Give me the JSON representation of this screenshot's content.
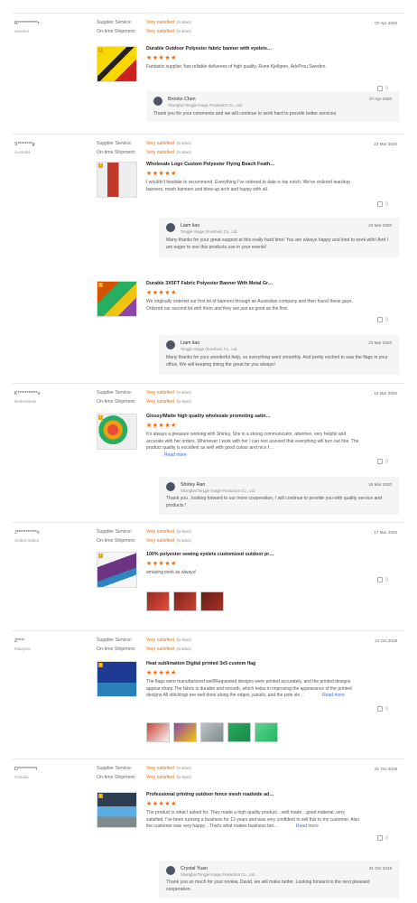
{
  "labels": {
    "supplier_service": "Supplier Service:",
    "ontime_shipment": "On-time Shipment:",
    "very_satisfied": "Very satisfied",
    "five_stars": "(5 stars)",
    "read_more": "Read more"
  },
  "reviews": [
    {
      "buyer": "R***********r",
      "country": "Sweden",
      "date": "07 Apr 2020",
      "products": [
        {
          "title": "Durable Outdoor Polyester fabric banner with eyelets…",
          "stars": "★★★★★",
          "comment": "Fantastic supplier, fast reliable deliveries of high quality. Rune Kjellgren, AdvProu Sweden.",
          "likes": "0",
          "tag": "I"
        }
      ],
      "reply": {
        "name": "Brooks Chen",
        "company": "Shanghai Tongjie Image Production Co., Ltd.",
        "date": "07 Apr 2020",
        "text": "Thank you for your comments and we will continue to work hard to provide better services."
      }
    },
    {
      "buyer": "S********g",
      "country": "Australia",
      "date": "23 Mar 2020",
      "products": [
        {
          "title": "Wholesale Logo Custom Polyester Flying Beach Feath…",
          "stars": "★★★★★",
          "comment": "I wouldn't hesitate to recommend. Everything I've ordered to date is top notch. We've ordered teardrop banners, mesh banners and blow-up arch and happy with all.",
          "likes": "0",
          "tag": "I",
          "reply": {
            "name": "Liam liao",
            "company": "Tongjie Image (Kunshan) Co., Ltd.",
            "date": "23 Mar 2020",
            "text": "Many thanks for your great support at this really hard time! You are always happy and kind to work with! And I am eager to see this products use in your events!"
          }
        },
        {
          "title": "Durable 3X5FT Fabric Polyester Banner With Metal Gr…",
          "stars": "★★★★★",
          "comment": "We originally ordered our first lot of banners through an Australian company and then found these guys. Ordered our second lot with them and they are just as good as the first.",
          "likes": "0",
          "tag": "I",
          "reply": {
            "name": "Liam liao",
            "company": "Tongjie Image (Kunshan) Co., Ltd.",
            "date": "23 Mar 2020",
            "text": "Many thanks for your wonderful help, so everything went smoothly. And pretty excited to saw the flags in your office, We will keeping doing the great for you always!"
          }
        }
      ]
    },
    {
      "buyer": "K***********o",
      "country": "Netherlands",
      "date": "18 Mar 2020",
      "products": [
        {
          "title": "Glossy/Matte high quality wholesale promoting satin…",
          "stars": "★★★★★",
          "comment": "It's always a pleasure working with Shirley. She is a strong communicator, attentive, very helpful and accurate with her orders. Whenever I work with her I can rest assured that everything will turn out fine. The product quality is excellent as well with good colour and nice f…",
          "likes": "0",
          "tag": "I"
        }
      ],
      "reply": {
        "name": "Shirley Ran",
        "company": "Shanghai Tongjie Image Production Co., Ltd.",
        "date": "18 Mar 2020",
        "text": "Thank you , looking forward to our more cooperation, I will continue to provide you with quality service and products !"
      }
    },
    {
      "buyer": "J***********n",
      "country": "United States",
      "date": "17 Mar 2020",
      "products": [
        {
          "title": "100% polyester sewing eyelets customized outdoor pr…",
          "stars": "★★★★★",
          "comment": "amazing work as always!",
          "likes": "0",
          "tag": "I"
        }
      ]
    },
    {
      "buyer": "Z****",
      "country": "Malaysia",
      "date": "13 Oct 2019",
      "products": [
        {
          "title": "Heat sublimation Digital printed 3x5 custom flag",
          "stars": "★★★★★",
          "comment": "The flags were manufactured well!Requested designs were printed accurately, and the printed designs appear sharp.The fabric is durable and smooth, which helps in improving the appearance of the printed designs.All stitchings are well done along the edges, panels, and the pole sle…",
          "likes": "0",
          "tag": "I"
        }
      ]
    },
    {
      "buyer": "D**********l",
      "country": "Canada",
      "date": "31 Oct 2019",
      "products": [
        {
          "title": "Professional printing outdoor fence mesh roadside ad…",
          "stars": "★★★★★",
          "comment": "The product is what I asked for. They made a high quality product…well made…good material..very satisfied. I've been running a business for 13 years and was very confident to sell this to my customer. Also the customer was very happy…That's what makes business bet…",
          "likes": "0",
          "tag": "I"
        }
      ],
      "reply": {
        "name": "Crystal Yuan",
        "company": "Shanghai Tongjie Image Production Co., Ltd.",
        "date": "31 Oct 2019",
        "text": "Thank you so much for your review, David, we will make better. Looking forward to the next pleasant cooperation."
      }
    }
  ]
}
